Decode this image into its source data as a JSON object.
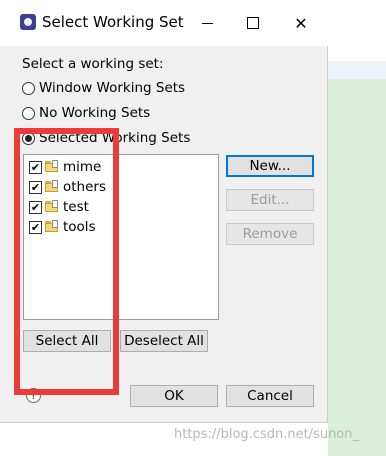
{
  "window": {
    "title": "Select Working Set",
    "controls": {
      "minimize": "–",
      "maximize": "□",
      "close": "✕"
    }
  },
  "prompt_label": "Select a working set:",
  "options": [
    {
      "label": "Window Working Sets",
      "selected": false
    },
    {
      "label": "No Working Sets",
      "selected": false
    },
    {
      "label": "Selected Working Sets",
      "selected": true
    }
  ],
  "working_sets": [
    {
      "name": "mime",
      "checked": true
    },
    {
      "name": "others",
      "checked": true
    },
    {
      "name": "test",
      "checked": true
    },
    {
      "name": "tools",
      "checked": true
    }
  ],
  "side_buttons": {
    "new": "New...",
    "edit": "Edit...",
    "remove": "Remove"
  },
  "bottom_buttons": {
    "select_all": "Select All",
    "deselect_all": "Deselect All"
  },
  "footer": {
    "help": "?",
    "ok": "OK",
    "cancel": "Cancel"
  },
  "watermark": "https://blog.csdn.net/sunon_"
}
